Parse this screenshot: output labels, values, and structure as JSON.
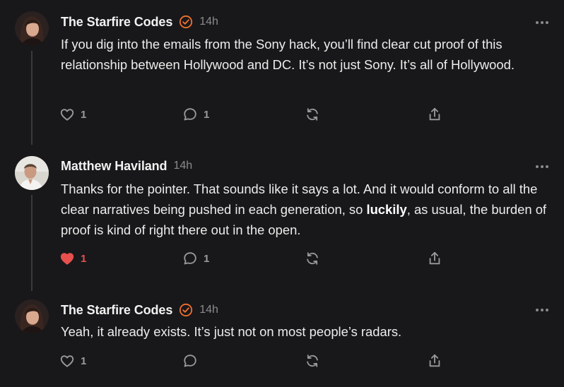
{
  "colors": {
    "background": "#18181a",
    "text": "#ececec",
    "muted": "#8b8b8f",
    "badge": "#f0702e",
    "like_active": "#e8504d",
    "thread_line": "#3a3a3d"
  },
  "replies": [
    {
      "author": "The Starfire Codes",
      "verified_badge_icon": "check-circle-icon",
      "time": "14h",
      "text": "If you dig into the emails from the Sony hack, you’ll find clear cut proof of this relationship between Hollywood and DC. It’s not just Sony. It’s all of Hollywood.",
      "likes": "1",
      "liked": false,
      "comments": "1"
    },
    {
      "author": "Matthew Haviland",
      "time": "14h",
      "text_before": "Thanks for the pointer. That sounds like it says a lot. And it would conform to all the clear narratives being pushed in each generation, so ",
      "text_bold": "luckily",
      "text_after": ", as usual, the burden of proof is kind of right there out in the open.",
      "likes": "1",
      "liked": true,
      "comments": "1"
    },
    {
      "author": "The Starfire Codes",
      "verified_badge_icon": "check-circle-icon",
      "time": "14h",
      "text": "Yeah, it already exists. It’s just not on most people’s radars.",
      "likes": "1",
      "liked": false,
      "comments": ""
    }
  ]
}
